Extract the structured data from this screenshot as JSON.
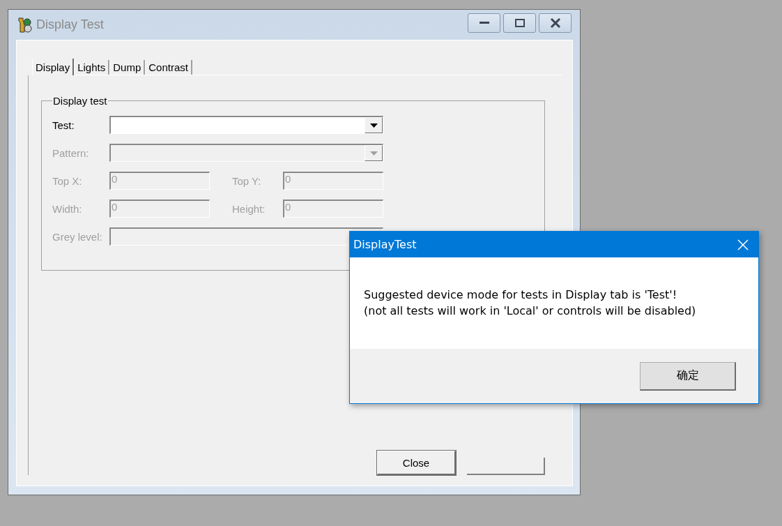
{
  "window": {
    "title": "Display Test",
    "active": false
  },
  "tabs": [
    {
      "label": "Display",
      "selected": true
    },
    {
      "label": "Lights",
      "selected": false
    },
    {
      "label": "Dump",
      "selected": false
    },
    {
      "label": "Contrast",
      "selected": false
    }
  ],
  "group": {
    "title": "Display test",
    "rows": [
      [
        {
          "kind": "combo",
          "label": "Test:",
          "disabled": false
        }
      ],
      [
        {
          "kind": "combo",
          "label": "Pattern:",
          "disabled": true
        }
      ],
      [
        {
          "kind": "text",
          "label": "Top X:",
          "value": "0",
          "disabled": true
        },
        {
          "kind": "text",
          "label": "Top Y:",
          "value": "0",
          "disabled": true
        }
      ],
      [
        {
          "kind": "text",
          "label": "Width:",
          "value": "0",
          "disabled": true
        },
        {
          "kind": "text",
          "label": "Height:",
          "value": "0",
          "disabled": true
        }
      ],
      [
        {
          "kind": "text",
          "label": "Grey level:",
          "disabled": true
        }
      ]
    ]
  },
  "buttons": [
    {
      "kind": "button",
      "label": "Close"
    },
    {
      "kind": "clipped"
    }
  ],
  "dialog": {
    "title": "DisplayTest",
    "message": [
      "Suggested device mode for tests in Display tab is 'Test'!",
      "(not all tests will work in 'Local' or controls will be disabled)"
    ],
    "button": "确定"
  }
}
